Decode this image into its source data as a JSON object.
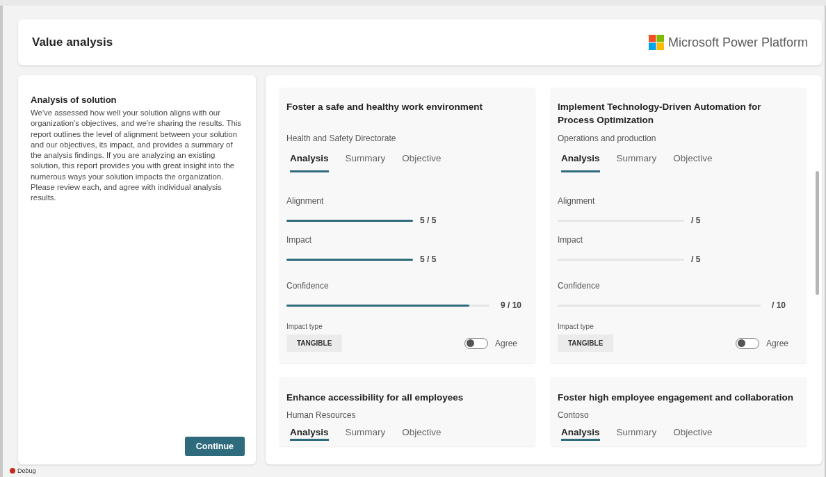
{
  "header": {
    "title": "Value analysis",
    "brand": "Microsoft Power Platform"
  },
  "intro": {
    "title": "Analysis of solution",
    "body": "We've assessed how well your solution aligns with our organization's objectives, and we're sharing the results. This report outlines the level of alignment between your solution and our objectives, its impact, and provides a summary of the analysis findings. If you are analyzing an existing solution, this report provides you with great insight into the numerous ways your solution impacts the organization. Please review each, and agree with individual analysis results.",
    "button": "Continue"
  },
  "cards": [
    {
      "title": "Foster a safe and healthy work environment",
      "department": "Health and Safety Directorate",
      "tabs": [
        {
          "label": "Analysis",
          "selected": true
        },
        {
          "label": "Summary",
          "selected": false
        },
        {
          "label": "Objective",
          "selected": false
        }
      ],
      "metrics": [
        {
          "label": "Alignment",
          "level": 1,
          "reading": "5 / 5",
          "kind": "short"
        },
        {
          "label": "Impact",
          "level": 1,
          "reading": "5 / 5",
          "kind": "short"
        },
        {
          "label": "Confidence",
          "level": 0.9,
          "reading": "9 / 10",
          "kind": "long"
        }
      ],
      "impact_type_label": "Impact type",
      "impact_type": "TANGIBLE",
      "agree": {
        "label": "Agree",
        "on": false
      }
    },
    {
      "title": "Implement Technology-Driven Automation for Process Optimization",
      "department": "Operations and production",
      "tabs": [
        {
          "label": "Analysis",
          "selected": true
        },
        {
          "label": "Summary",
          "selected": false
        },
        {
          "label": "Objective",
          "selected": false
        }
      ],
      "metrics": [
        {
          "label": "Alignment",
          "level": 0,
          "reading": "/ 5",
          "kind": "short"
        },
        {
          "label": "Impact",
          "level": 0,
          "reading": "/ 5",
          "kind": "short"
        },
        {
          "label": "Confidence",
          "level": 0,
          "reading": "/ 10",
          "kind": "long"
        }
      ],
      "impact_type_label": "Impact type",
      "impact_type": "TANGIBLE",
      "agree": {
        "label": "Agree",
        "on": false
      }
    },
    {
      "title": "Enhance accessibility for all employees",
      "department": "Human Resources",
      "tabs": [
        {
          "label": "Analysis",
          "selected": true
        },
        {
          "label": "Summary",
          "selected": false
        },
        {
          "label": "Objective",
          "selected": false
        }
      ]
    },
    {
      "title": "Foster high employee engagement and collaboration",
      "department": "Contoso",
      "tabs": [
        {
          "label": "Analysis",
          "selected": true
        },
        {
          "label": "Summary",
          "selected": false
        },
        {
          "label": "Objective",
          "selected": false
        }
      ]
    }
  ],
  "status_bar": {
    "label": "Debug"
  }
}
